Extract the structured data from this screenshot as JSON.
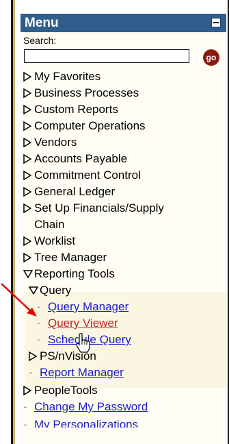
{
  "menu": {
    "title": "Menu",
    "search_label": "Search:",
    "search_value": "",
    "go_label": "go",
    "items": [
      {
        "label": "My Favorites"
      },
      {
        "label": "Business Processes"
      },
      {
        "label": "Custom Reports"
      },
      {
        "label": "Computer Operations"
      },
      {
        "label": "Vendors"
      },
      {
        "label": "Accounts Payable"
      },
      {
        "label": "Commitment Control"
      },
      {
        "label": "General Ledger"
      },
      {
        "label": "Set Up Financials/Supply"
      },
      {
        "label": "Chain"
      },
      {
        "label": "Worklist"
      },
      {
        "label": "Tree Manager"
      },
      {
        "label": "Reporting Tools"
      },
      {
        "label": "Query"
      },
      {
        "label": "Query Manager"
      },
      {
        "label": "Query Viewer"
      },
      {
        "label": "Schedule Query"
      },
      {
        "label": "PS/nVision"
      },
      {
        "label": "Report Manager"
      },
      {
        "label": "PeopleTools"
      },
      {
        "label": "Change My Password"
      },
      {
        "label": "My Personalizations"
      }
    ]
  },
  "colors": {
    "header": "#2f5e8c",
    "link": "#1f20c8",
    "visited": "#c0242a",
    "highlight": "#fbf6e1",
    "arrow": "#e00000"
  }
}
